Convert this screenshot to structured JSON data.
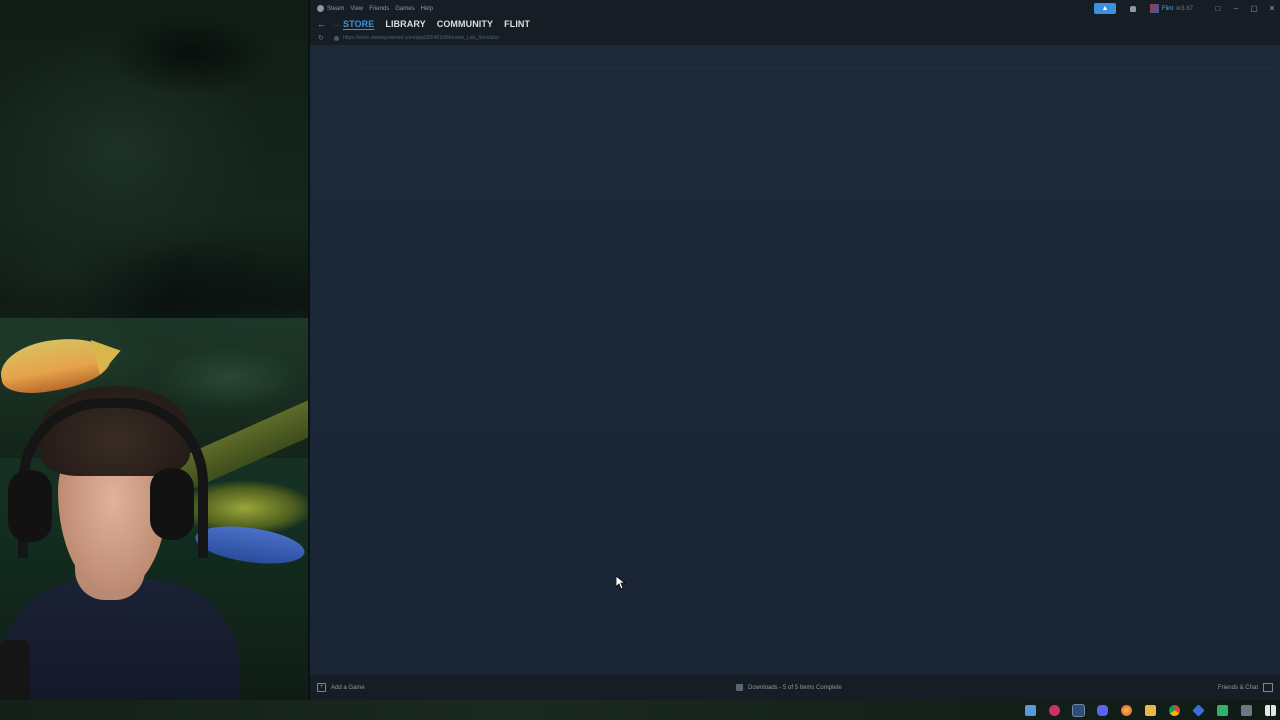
{
  "menu": [
    "Steam",
    "View",
    "Friends",
    "Games",
    "Help"
  ],
  "user": {
    "name": "Flint",
    "wallet": "kr3.87"
  },
  "nav_tabs": [
    "STORE",
    "LIBRARY",
    "COMMUNITY",
    "FLINT"
  ],
  "url": "https://store.steampowered.com/app/3054610/Monster_Lab_Simulator",
  "bottom": {
    "add_game": "Add a Game",
    "downloads": "Downloads - 5 of 5 Items Complete",
    "friends_chat": "Friends & Chat"
  },
  "icons": {
    "back": "arrow-left-icon",
    "forward": "arrow-right-icon",
    "reload": "reload-icon",
    "lock": "lock-icon",
    "bell": "bell-icon",
    "announce": "megaphone-icon"
  },
  "colors": {
    "accent": "#3b93e0",
    "steam_bg": "#1b2838",
    "chrome": "#171d25"
  },
  "taskbar_icons": [
    "snip-icon",
    "media-icon",
    "steam-icon",
    "discord-icon",
    "firefox-icon",
    "folder-icon",
    "chrome-icon",
    "app-icon",
    "app-icon-2",
    "app-icon-3",
    "windows-icon"
  ]
}
